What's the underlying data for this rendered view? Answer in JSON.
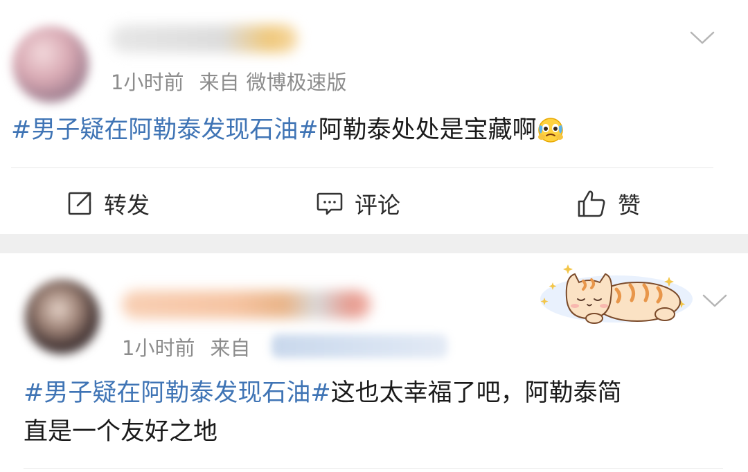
{
  "posts": [
    {
      "time": "1小时前",
      "source_prefix": "来自",
      "source": "微博极速版",
      "topic": "#男子疑在阿勒泰发现石油#",
      "text": "阿勒泰处处是宝藏啊",
      "emoji_icon": "crying-happy-emoji-icon",
      "actions": {
        "repost": "转发",
        "comment": "评论",
        "like": "赞"
      }
    },
    {
      "time": "1小时前",
      "source_prefix": "来自",
      "topic": "#男子疑在阿勒泰发现石油#",
      "text_line1": "这也太幸福了吧，阿勒泰简",
      "text_line2": "直是一个友好之地",
      "decoration_icon": "sleeping-cat-sticker"
    }
  ],
  "colors": {
    "topic": "#3f74b5",
    "text": "#1a1a1a",
    "meta": "#8c8c8c",
    "separator": "#efefef"
  }
}
